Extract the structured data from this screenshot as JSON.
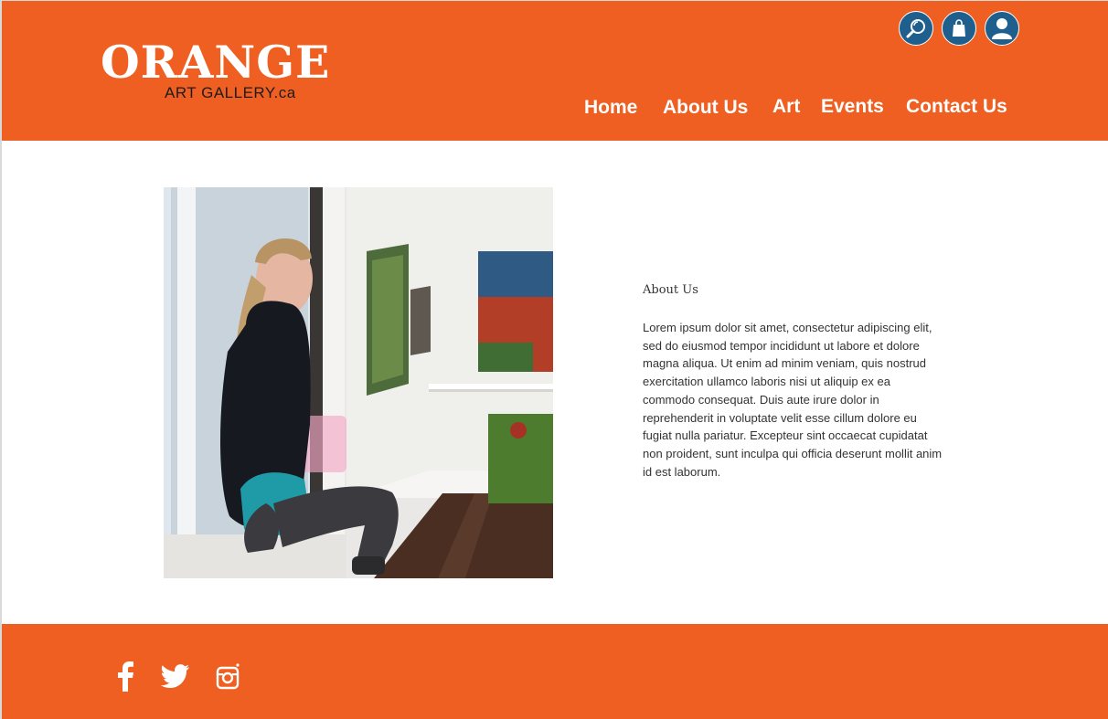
{
  "brand": {
    "name": "ORANGE",
    "tagline": "ART GALLERY.ca"
  },
  "header_icons": {
    "search": "search-icon",
    "cart": "shopping-bag-icon",
    "account": "user-icon"
  },
  "nav": {
    "home": "Home",
    "about": "About Us",
    "art": "Art",
    "events": "Events",
    "contact": "Contact Us"
  },
  "about": {
    "heading": "About Us",
    "body": "Lorem ipsum dolor sit amet, consectetur adipiscing elit, sed do eiusmod tempor incididunt ut labore et dolore magna aliqua. Ut enim ad minim veniam, quis nostrud exercitation ullamco laboris nisi ut aliquip ex ea commodo consequat. Duis aute irure dolor in reprehenderit in voluptate velit esse cillum dolore eu fugiat nulla pariatur. Excepteur sint occaecat cupidatat non proident, sunt inculpa qui officia deserunt mollit anim id est laborum."
  },
  "social": {
    "facebook": "facebook-icon",
    "twitter": "twitter-icon",
    "instagram": "instagram-icon"
  },
  "colors": {
    "brand_orange": "#ef5f22",
    "icon_blue": "#1e5f8e",
    "text_dark": "#333333"
  }
}
